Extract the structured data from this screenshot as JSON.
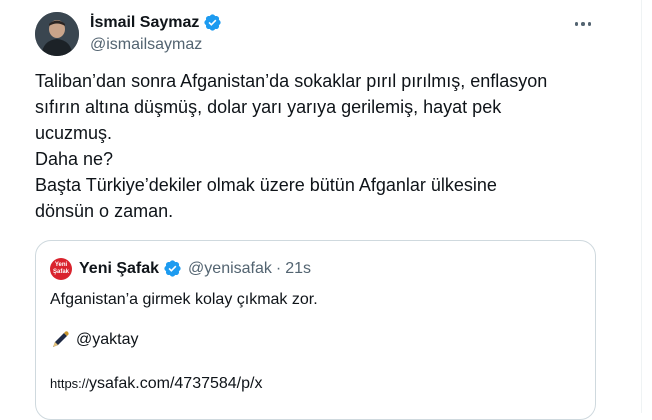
{
  "author": {
    "name": "İsmail Saymaz",
    "handle": "@ismailsaymaz",
    "verified_icon": "verified-badge-icon",
    "verified_color": "#1d9bf0"
  },
  "more_icon": "more-dots-icon",
  "tweet": {
    "lines": [
      "Taliban’dan sonra Afganistan’da sokaklar pırıl pırılmış, enflasyon",
      "sıfırın altına düşmüş, dolar yarı yarıya gerilemiş, hayat pek",
      "ucuzmuş.",
      "Daha ne?",
      "Başta Türkiye’dekiler olmak üzere bütün Afganlar ülkesine",
      "dönsün o zaman."
    ]
  },
  "quote": {
    "logo_text_1": "Yeni",
    "logo_text_2": "Şafak",
    "logo_color": "#d9232d",
    "name": "Yeni Şafak",
    "handle": "@yenisafak",
    "separator": "·",
    "time": "21s",
    "text": "Afganistan’a girmek kolay çıkmak zor.",
    "pen_icon": "pen-icon",
    "mention": "@yaktay",
    "link_proto": "https://",
    "link_rest": "ysafak.com/4737584/p/x"
  }
}
